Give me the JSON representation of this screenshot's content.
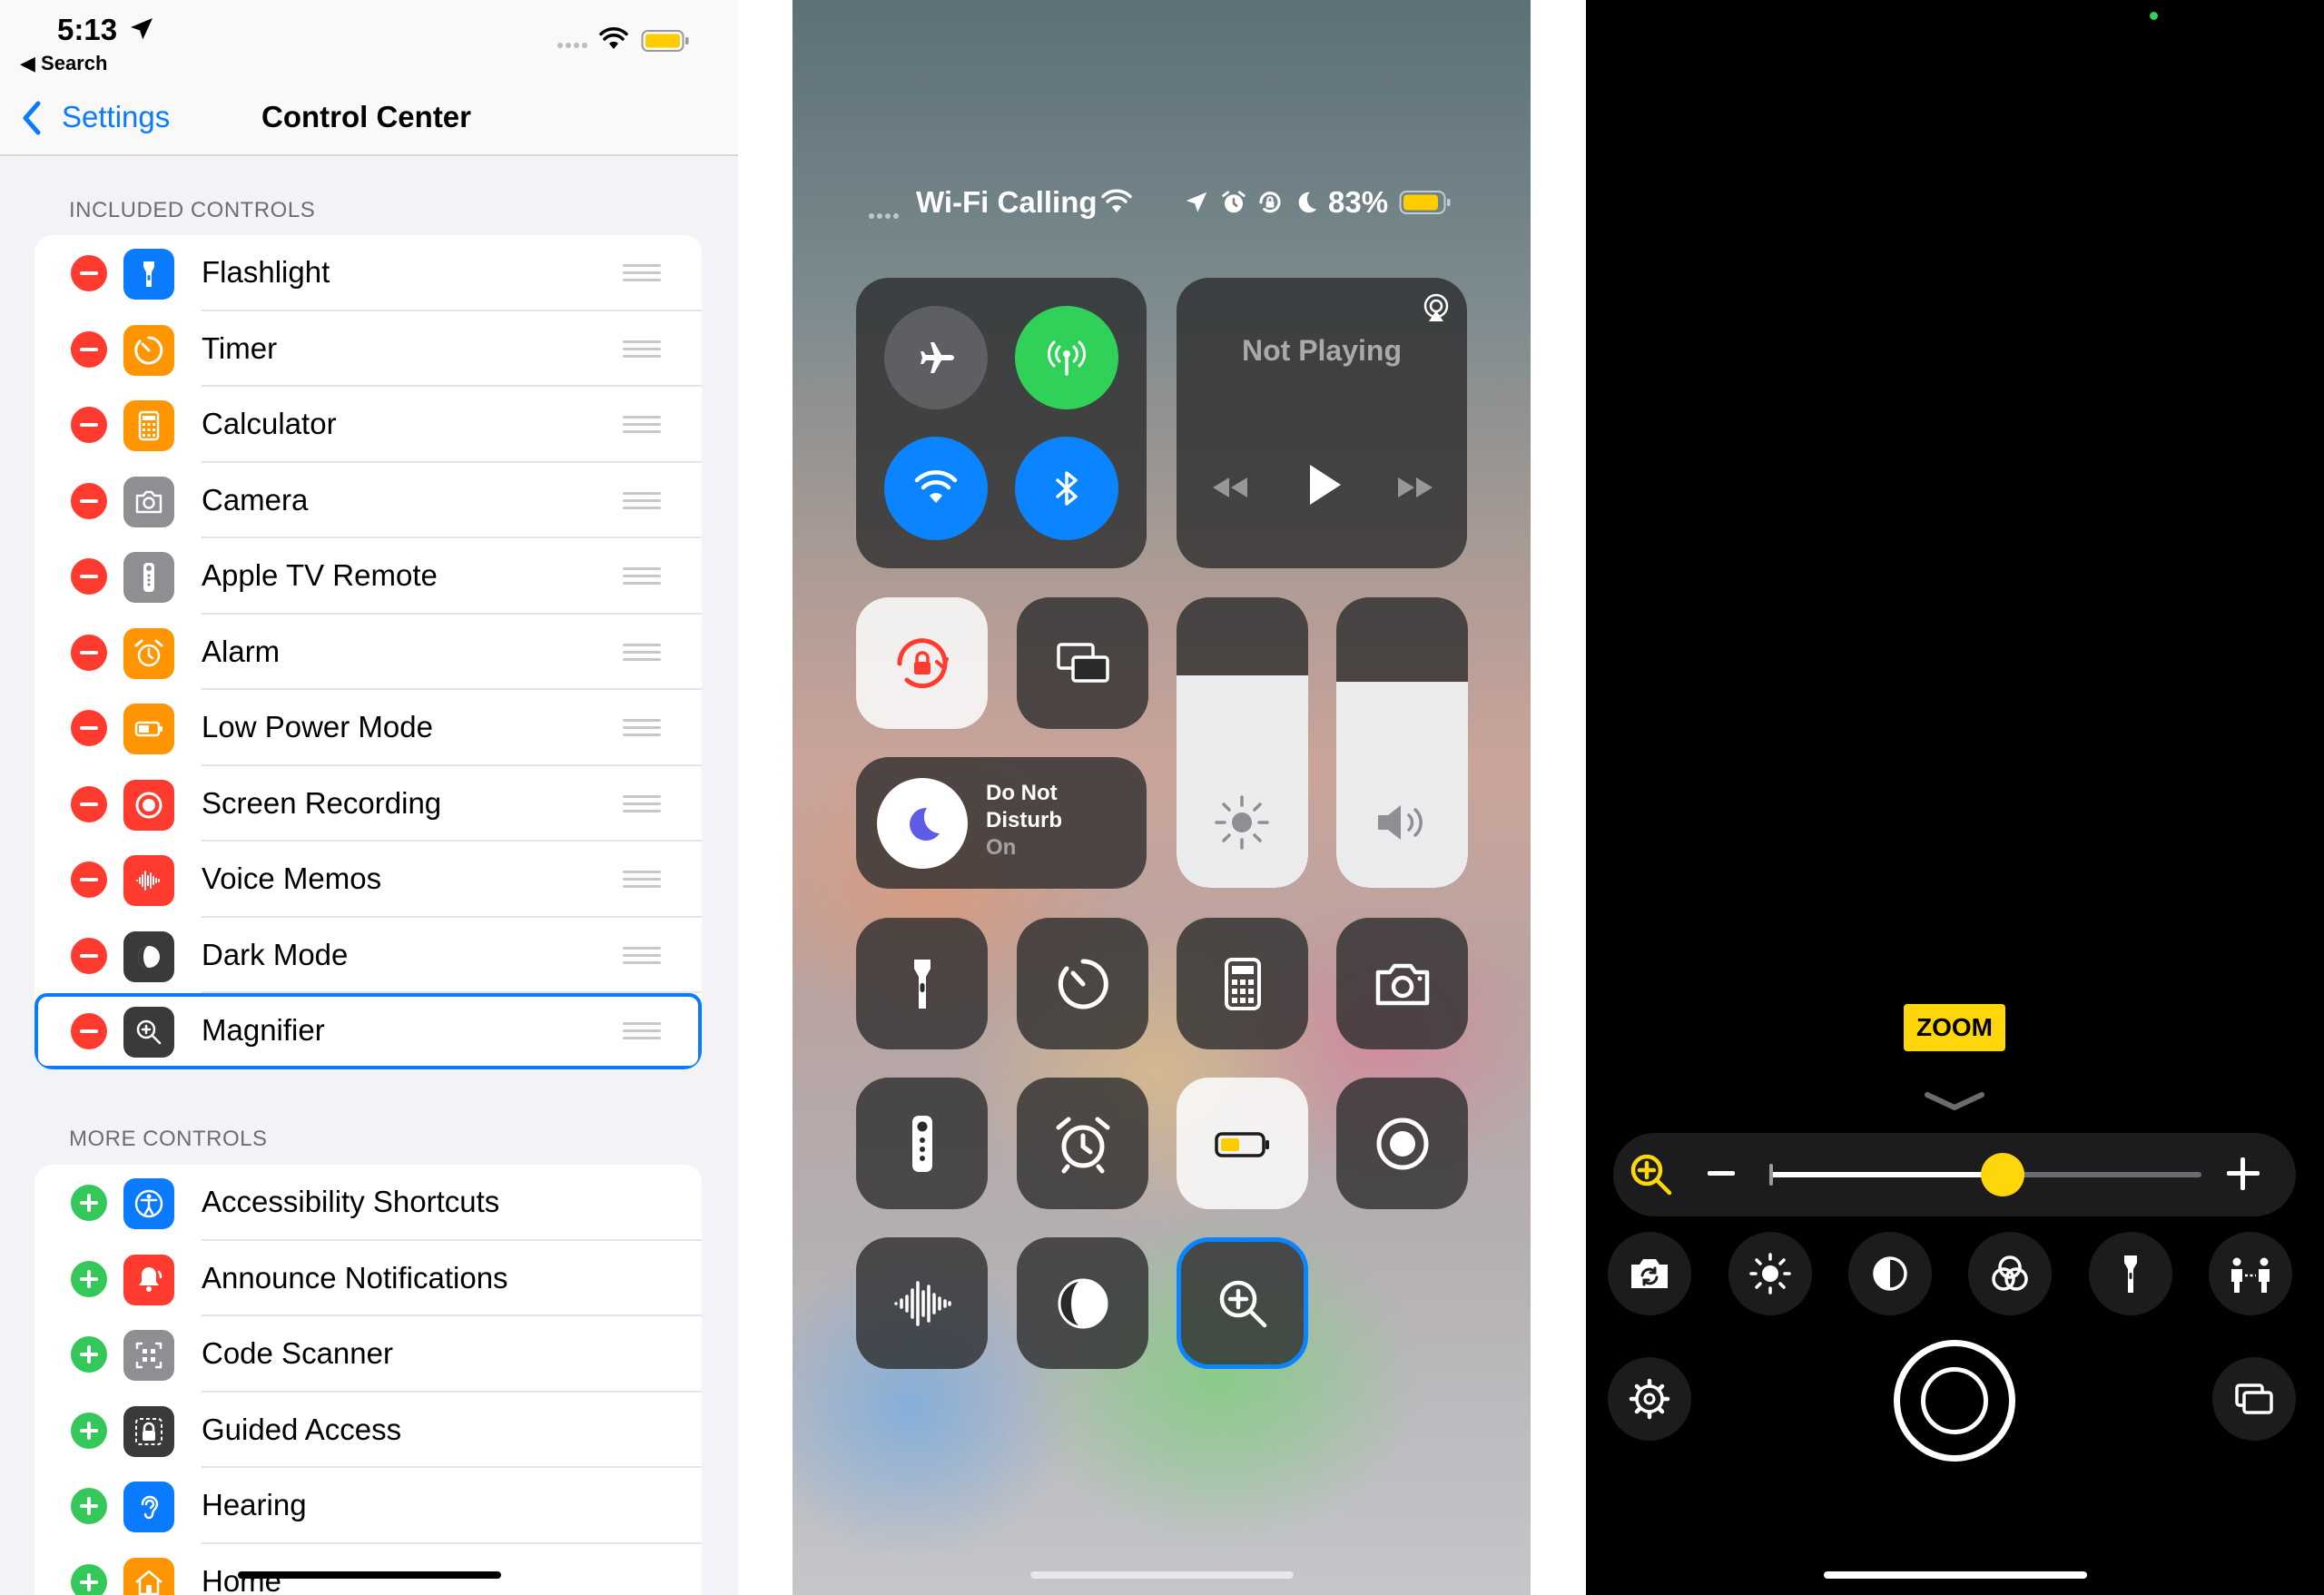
{
  "settings": {
    "status_bar": {
      "time": "5:13",
      "back_app": "◀ Search"
    },
    "nav": {
      "back_label": "Settings",
      "title": "Control Center"
    },
    "included_header": "INCLUDED CONTROLS",
    "included": [
      {
        "label": "Flashlight",
        "icon": "flashlight-icon",
        "color": "#0a7aff"
      },
      {
        "label": "Timer",
        "icon": "timer-icon",
        "color": "#ff9500"
      },
      {
        "label": "Calculator",
        "icon": "calculator-icon",
        "color": "#ff9500"
      },
      {
        "label": "Camera",
        "icon": "camera-icon",
        "color": "#8e8e93"
      },
      {
        "label": "Apple TV Remote",
        "icon": "remote-icon",
        "color": "#8e8e93"
      },
      {
        "label": "Alarm",
        "icon": "alarm-icon",
        "color": "#ff9500"
      },
      {
        "label": "Low Power Mode",
        "icon": "battery-icon",
        "color": "#ff9500"
      },
      {
        "label": "Screen Recording",
        "icon": "screen-record-icon",
        "color": "#ff3b30"
      },
      {
        "label": "Voice Memos",
        "icon": "waveform-icon",
        "color": "#ff3b30"
      },
      {
        "label": "Dark Mode",
        "icon": "dark-mode-icon",
        "color": "#3a3a3c"
      },
      {
        "label": "Magnifier",
        "icon": "magnifier-icon",
        "color": "#3a3a3c"
      }
    ],
    "more_header": "MORE CONTROLS",
    "more": [
      {
        "label": "Accessibility Shortcuts",
        "icon": "accessibility-icon",
        "color": "#0a7aff"
      },
      {
        "label": "Announce Notifications",
        "icon": "announce-bell-icon",
        "color": "#ff3b30"
      },
      {
        "label": "Code Scanner",
        "icon": "qr-code-icon",
        "color": "#8e8e93"
      },
      {
        "label": "Guided Access",
        "icon": "lock-icon",
        "color": "#3a3a3c"
      },
      {
        "label": "Hearing",
        "icon": "ear-icon",
        "color": "#0a7aff"
      },
      {
        "label": "Home",
        "icon": "home-icon",
        "color": "#ff9500"
      }
    ]
  },
  "control_center": {
    "carrier": "Wi-Fi Calling",
    "battery_pct": "83%",
    "now_playing": "Not Playing",
    "dnd": {
      "line1": "Do Not",
      "line2": "Disturb",
      "status": "On"
    },
    "colors": {
      "cellular": "#30d158",
      "wifi": "#0a84ff",
      "bluetooth": "#0a84ff",
      "focus_ring": "#0a84ff"
    },
    "brightness_level": 0.73,
    "volume_level": 0.71
  },
  "magnifier": {
    "zoom_label": "ZOOM",
    "zoom_level": 0.54,
    "accent": "#ffd60a",
    "controls_row1": [
      "switch-camera-icon",
      "brightness-icon",
      "contrast-icon",
      "filters-icon",
      "flashlight-icon",
      "people-detection-icon"
    ],
    "controls_row2": [
      "settings-gear-icon",
      "shutter-button",
      "multi-capture-icon"
    ]
  }
}
